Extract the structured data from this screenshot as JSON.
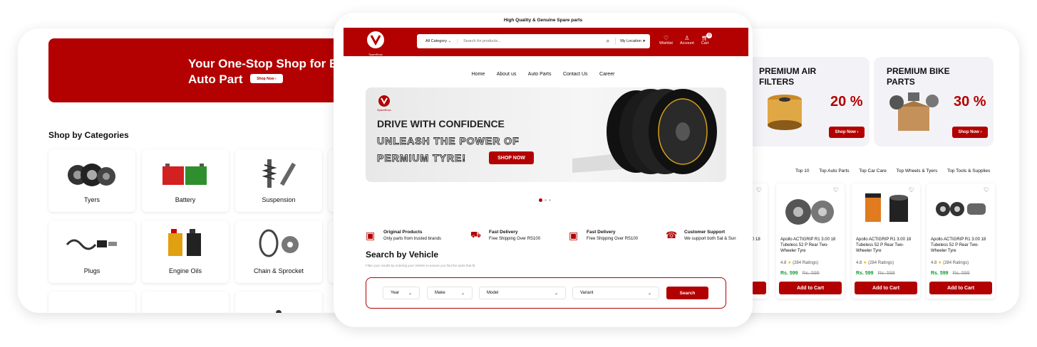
{
  "left": {
    "banner_line1": "Your One-Stop Shop for E",
    "banner_line2": "Auto Part",
    "banner_btn": "Shop Now",
    "categories_title": "Shop by Categories",
    "categories": [
      "Tyers",
      "Battery",
      "Suspension",
      "Plugs",
      "Engine Oils",
      "Chain & Sprocket"
    ]
  },
  "center": {
    "top_bar": "High Quality & Genuine Spare parts",
    "logo_text": "SpareBoss",
    "search": {
      "category": "All Category",
      "placeholder": "Search for products..."
    },
    "location": "My Location",
    "header_actions": [
      "Wishlist",
      "Account",
      "Cart"
    ],
    "cart_count": "0",
    "nav": [
      "Home",
      "About us",
      "Auto Parts",
      "Contact Us",
      "Career"
    ],
    "hero": {
      "brand": "SpareBoss",
      "line1": "DRIVE WITH CONFIDENCE",
      "line2": "UNLEASH THE POWER OF",
      "line3": "PERMIUM TYRE!",
      "cta": "SHOP NOW"
    },
    "features": [
      {
        "title": "Original Products",
        "sub": "Only parts from trusted brands"
      },
      {
        "title": "Fast Delivery",
        "sub": "Free Shipping Over RS100"
      },
      {
        "title": "Fast Delivery",
        "sub": "Free Shipping Over RS100"
      },
      {
        "title": "Customer Support",
        "sub": "We support both Sat & Sun"
      }
    ],
    "vehicle": {
      "title": "Search by Vehicle",
      "sub": "Filter your results by entering your Vehicle to ensure you find the parts that fit.",
      "year": "Year",
      "make": "Make",
      "model": "Model",
      "variant": "Variant",
      "search_btn": "Search"
    }
  },
  "right": {
    "promo1": {
      "title1": "PREMIUM AIR",
      "title2": "FILTERS",
      "pct": "20 %",
      "btn": "Shop Now"
    },
    "promo2": {
      "title1": "PREMIUM BIKE",
      "title2": "PARTS",
      "pct": "30 %",
      "btn": "Shop Now"
    },
    "tabs": [
      "Top 10",
      "Top Auto Parts",
      "Top Car Care",
      "Top Wheels & Tyers",
      "Top Tools & Supplies"
    ],
    "partial_name": "0 18",
    "product": {
      "name": "Apollo ACTIGRIP R1 3.00 18 Tubeless 52 P Rear Two-Wheeler Tyre",
      "rating": "4.8",
      "ratings_count": "(284 Ratings)",
      "price": "Rs. 599",
      "old_price": "Rs. 599",
      "add_to_cart": "Add to Cart"
    }
  },
  "colors": {
    "brand_red": "#b30000",
    "price_green": "#139a3a"
  }
}
